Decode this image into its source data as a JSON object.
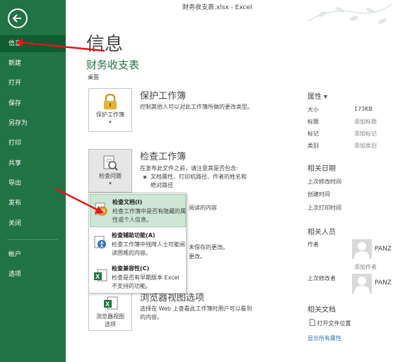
{
  "window": {
    "title": "财务收支表.xlsx - Excel"
  },
  "nav": {
    "items": [
      {
        "label": "信息",
        "active": true
      },
      {
        "label": "新建"
      },
      {
        "label": "打开"
      },
      {
        "label": "保存"
      },
      {
        "label": "另存为"
      },
      {
        "label": "打印"
      },
      {
        "label": "共享"
      },
      {
        "label": "导出"
      },
      {
        "label": "发布"
      },
      {
        "label": "关闭"
      },
      {
        "label": "帐户"
      },
      {
        "label": "选项"
      }
    ]
  },
  "main": {
    "heading": "信息",
    "file_name": "财务收支表",
    "file_location": "桌面",
    "protect": {
      "button_label": "保护工作簿",
      "title": "保护工作簿",
      "desc": "控制其他人可以对此工作簿所做的更改类型。"
    },
    "inspect": {
      "button_label": "检查问题",
      "title": "检查工作簿",
      "desc": "在发布此文件之前，请注意其是否包含:",
      "bullets": [
        "文档属性、打印机路径、作者的姓名和绝对路径"
      ],
      "partial_text": "阅读的内容"
    },
    "versions": {
      "line1": "未保存的更改。",
      "line2": "更改。"
    },
    "browser": {
      "title": "浏览器视图选项",
      "button_label_1": "浏览器视图",
      "button_label_2": "选项",
      "desc_1": "选择在 Web 上查看此工作簿时用户可以看到",
      "desc_2": "的内容。"
    }
  },
  "dropdown": {
    "items": [
      {
        "title": "检查文档(I)",
        "desc": "检查工作簿中是否有隐藏的属性或个人信息。",
        "highlighted": true
      },
      {
        "title": "检查辅助功能(A)",
        "desc": "检查工作簿中残障人士可能阅读困难的内容。"
      },
      {
        "title": "检查兼容性(C)",
        "desc": "检查是否有早期版本 Excel 不支持的功能。"
      }
    ]
  },
  "properties": {
    "title": "属性",
    "rows": [
      {
        "key": "大小",
        "value": "173KB",
        "muted": false
      },
      {
        "key": "标题",
        "value": "添加标题",
        "muted": true
      },
      {
        "key": "标记",
        "value": "添加标记",
        "muted": true
      },
      {
        "key": "类别",
        "value": "添加类别",
        "muted": true
      }
    ],
    "dates_title": "相关日期",
    "dates": [
      "上次修改时间",
      "创建时间",
      "上次打印时间"
    ],
    "people_title": "相关人员",
    "author_label": "作者",
    "author_name": "PANZ",
    "add_author": "添加作者",
    "last_modified_by_label": "上次修改者",
    "last_modified_by_name": "PANZ",
    "docs_title": "相关文档",
    "open_location": "打开文件位置",
    "show_all": "显示所有属性"
  },
  "colors": {
    "accent": "#217346",
    "highlight": "#cde6d5",
    "arrow": "#e0161b",
    "link": "#2e75b6"
  }
}
